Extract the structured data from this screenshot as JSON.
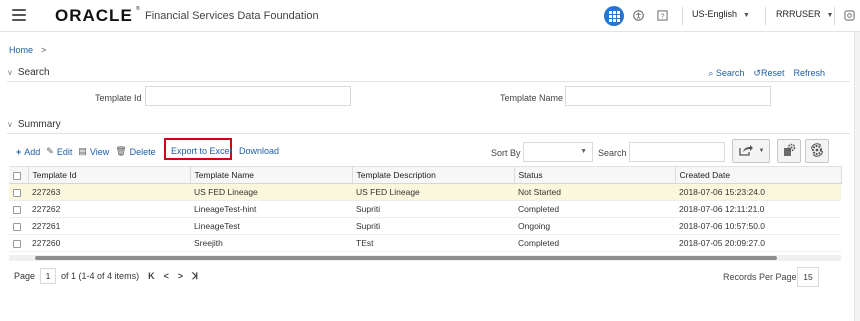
{
  "header": {
    "logo_text": "ORACLE",
    "logo_registered": "®",
    "app_title": "Financial Services Data Foundation",
    "language": "US-English",
    "user": "RRRUSER"
  },
  "breadcrumb": {
    "home": "Home",
    "separator": ">"
  },
  "search_section": {
    "title": "Search",
    "search_link": "Search",
    "reset_link": "Reset",
    "refresh_link": "Refresh",
    "template_id_label": "Template Id",
    "template_id_value": "",
    "template_name_label": "Template Name",
    "template_name_value": ""
  },
  "summary_section": {
    "title": "Summary",
    "toolbar": {
      "add": "Add",
      "edit": "Edit",
      "view": "View",
      "delete": "Delete",
      "export": "Export to Excel",
      "download": "Download"
    },
    "sort_by_label": "Sort By",
    "sort_by_value": "",
    "search_label": "Search",
    "search_value": ""
  },
  "table": {
    "columns": [
      "Template Id",
      "Template Name",
      "Template Description",
      "Status",
      "Created Date"
    ],
    "rows": [
      {
        "id": "227263",
        "name": "US FED Lineage",
        "description": "US FED Lineage",
        "status": "Not Started",
        "created": "2018-07-06 15:23:24.0"
      },
      {
        "id": "227262",
        "name": "LineageTest-hint",
        "description": "Supriti",
        "status": "Completed",
        "created": "2018-07-06 12:11:21.0"
      },
      {
        "id": "227261",
        "name": "LineageTest",
        "description": "Supriti",
        "status": "Ongoing",
        "created": "2018-07-06 10:57:50.0"
      },
      {
        "id": "227260",
        "name": "Sreejith",
        "description": "TEst",
        "status": "Completed",
        "created": "2018-07-05 20:09:27.0"
      }
    ]
  },
  "pagination": {
    "page_label": "Page",
    "page_value": "1",
    "page_info": "of 1 (1-4 of 4 items)",
    "first": "K",
    "prev": "<",
    "next": ">",
    "last": "ꓘ",
    "records_per_page_label": "Records Per Page",
    "records_per_page_value": "15"
  },
  "icons": {
    "menu": "hamburger-icon",
    "apps": "apps-grid-icon",
    "accessibility": "accessibility-icon",
    "help": "help-icon",
    "settings": "gear-icon"
  },
  "colors": {
    "link": "#1d5fa8",
    "apps_button": "#2a74c9",
    "highlight_box": "#d0021b",
    "selected_row": "#fbf7dd"
  }
}
